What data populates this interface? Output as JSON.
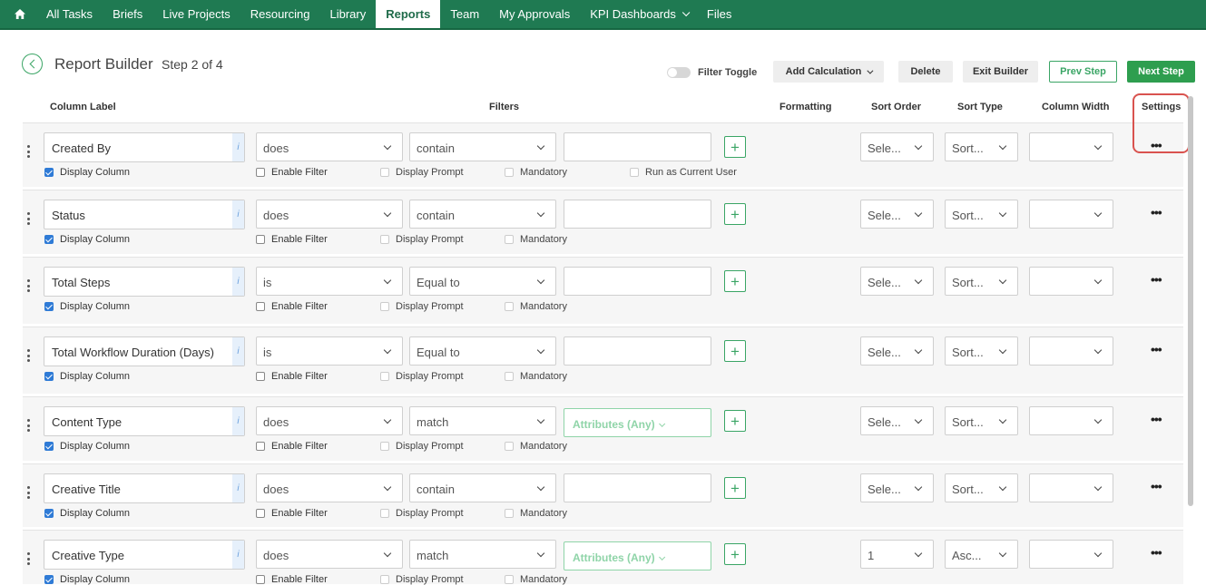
{
  "nav": {
    "home_icon": "home-icon",
    "items": [
      {
        "label": "All Tasks"
      },
      {
        "label": "Briefs"
      },
      {
        "label": "Live Projects"
      },
      {
        "label": "Resourcing"
      },
      {
        "label": "Library"
      },
      {
        "label": "Reports",
        "active": true
      },
      {
        "label": "Team"
      },
      {
        "label": "My Approvals"
      },
      {
        "label": "KPI Dashboards"
      },
      {
        "label": "Files"
      }
    ]
  },
  "header": {
    "title": "Report Builder",
    "step": "Step 2 of 4",
    "filter_toggle_label": "Filter Toggle",
    "add_calculation_label": "Add Calculation",
    "delete_label": "Delete",
    "exit_builder_label": "Exit Builder",
    "prev_step_label": "Prev Step",
    "next_step_label": "Next Step"
  },
  "columns": {
    "column_label": "Column Label",
    "filters": "Filters",
    "formatting": "Formatting",
    "sort_order": "Sort Order",
    "sort_type": "Sort Type",
    "column_width": "Column Width",
    "settings": "Settings"
  },
  "checkbox_labels": {
    "display_column": "Display Column",
    "enable_filter": "Enable Filter",
    "display_prompt": "Display Prompt",
    "mandatory": "Mandatory",
    "run_as_current_user": "Run as Current User"
  },
  "rows": [
    {
      "label": "Created By",
      "operator": "does",
      "condition": "contain",
      "value": "",
      "sort_order": "Sele...",
      "sort_type": "Sort...",
      "column_width": "",
      "display_column": true,
      "enable_filter": false,
      "run_as_current_user": true
    },
    {
      "label": "Status",
      "operator": "does",
      "condition": "contain",
      "value": "",
      "sort_order": "Sele...",
      "sort_type": "Sort...",
      "column_width": "",
      "display_column": true,
      "enable_filter": false
    },
    {
      "label": "Total Steps",
      "operator": "is",
      "condition": "Equal to",
      "value": "",
      "sort_order": "Sele...",
      "sort_type": "Sort...",
      "column_width": "",
      "display_column": true,
      "enable_filter": false
    },
    {
      "label": "Total Workflow Duration (Days)",
      "operator": "is",
      "condition": "Equal to",
      "value": "",
      "sort_order": "Sele...",
      "sort_type": "Sort...",
      "column_width": "",
      "display_column": true,
      "enable_filter": false
    },
    {
      "label": "Content Type",
      "operator": "does",
      "condition": "match",
      "value": "Attributes (Any)",
      "sort_order": "Sele...",
      "sort_type": "Sort...",
      "column_width": "",
      "display_column": true,
      "enable_filter": false
    },
    {
      "label": "Creative Title",
      "operator": "does",
      "condition": "contain",
      "value": "",
      "sort_order": "Sele...",
      "sort_type": "Sort...",
      "column_width": "",
      "display_column": true,
      "enable_filter": false
    },
    {
      "label": "Creative Type",
      "operator": "does",
      "condition": "match",
      "value": "Attributes (Any)",
      "sort_order": "1",
      "sort_type": "Asc...",
      "column_width": "",
      "display_column": true,
      "enable_filter": false
    }
  ],
  "colors": {
    "nav_bg": "#1f7a52",
    "accent_green": "#2e9e4f",
    "highlight_red": "#d9534f",
    "checkbox_blue": "#2f7bd6"
  }
}
